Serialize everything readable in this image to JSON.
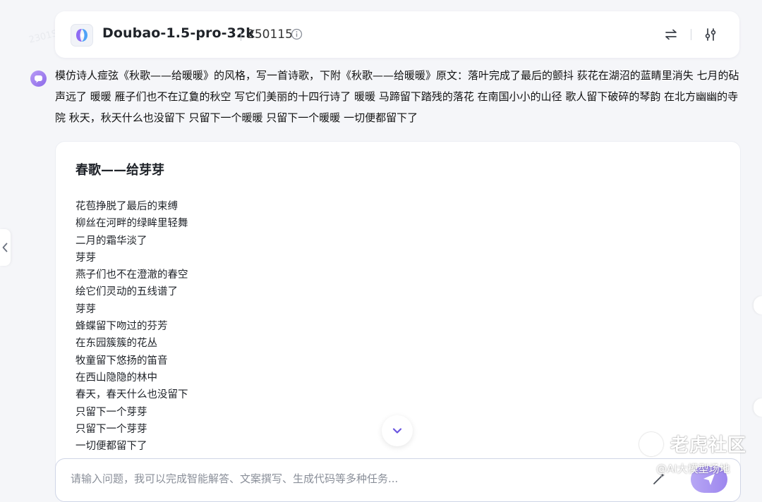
{
  "header": {
    "model_name": "Doubao-1.5-pro-32k",
    "version": "250115",
    "icons": [
      "doubao-logo",
      "info-icon",
      "swap-arrows-icon",
      "tune-sliders-icon"
    ]
  },
  "prompt": {
    "text": "模仿诗人痖弦《秋歌——给暖暖》的风格，写一首诗歌，下附《秋歌——给暖暖》原文：落叶完成了最后的颤抖 荻花在湖沼的蓝睛里消失 七月的砧声远了 暖暖 雁子们也不在辽敻的秋空 写它们美丽的十四行诗了 暖暖 马蹄留下踏残的落花 在南国小小的山径 歌人留下破碎的琴韵 在北方幽幽的寺院 秋天，秋天什么也没留下 只留下一个暖暖 只留下一个暖暖 一切便都留下了"
  },
  "answer": {
    "title": "春歌——给芽芽",
    "lines": [
      "花苞挣脱了最后的束缚",
      "柳丝在河畔的绿眸里轻舞",
      "二月的霜华淡了",
      "芽芽",
      "燕子们也不在澄澈的春空",
      "绘它们灵动的五线谱了",
      "芽芽",
      "蜂蝶留下吻过的芬芳",
      "在东园簇簇的花丛",
      "牧童留下悠扬的笛音",
      "在西山隐隐的林中",
      "春天，春天什么也没留下",
      "只留下一个芽芽",
      "只留下一个芽芽",
      "一切便都留下了"
    ]
  },
  "input": {
    "placeholder": "请输入问题，我可以完成智能解答、文案撰写、生成代码等多种任务..."
  },
  "watermark": {
    "brand": "老虎社区",
    "sub": "@AI大模型场地"
  },
  "colors": {
    "accent": "#9d86ee",
    "background": "#f5f6f9",
    "card": "#ffffff"
  }
}
